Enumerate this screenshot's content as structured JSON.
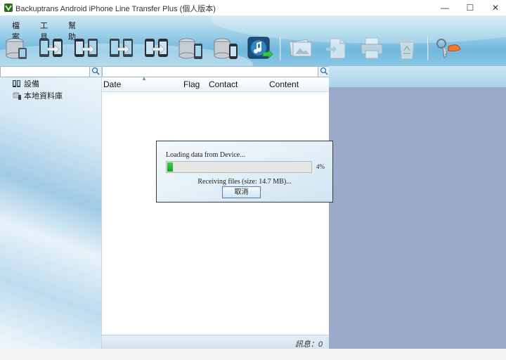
{
  "window": {
    "title": "Backuptrans Android iPhone Line Transfer Plus (個人版本)",
    "min_glyph": "—",
    "max_glyph": "☐",
    "close_glyph": "✕"
  },
  "menu": [
    "檔案",
    "工具",
    "幫助"
  ],
  "toolbar_icons": [
    "backup-database-icon",
    "transfer-android-to-iphone-icon",
    "transfer-iphone-to-android-icon",
    "transfer-android-to-android-icon",
    "transfer-iphone-to-iphone-icon",
    "restore-to-android-icon",
    "restore-to-iphone-icon",
    "itunes-sync-icon",
    "export-photos-icon",
    "export-file-icon",
    "print-icon",
    "delete-recycle-icon",
    "register-key-icon"
  ],
  "tree": [
    "設備",
    "本地資料庫"
  ],
  "columns": {
    "date": "Date",
    "flag": "Flag",
    "contact": "Contact",
    "content": "Content"
  },
  "status": {
    "messages": "訊息：0"
  },
  "dialog": {
    "loading": "Loading data from Device...",
    "percent_label": "4%",
    "progress_fraction": 0.04,
    "receiving": "Receiving files (size: 14.7 MB)...",
    "cancel": "取消"
  },
  "colors": {
    "accent": "#6fb8de",
    "progress": "#12a524",
    "right_panel": "#99abc9"
  }
}
